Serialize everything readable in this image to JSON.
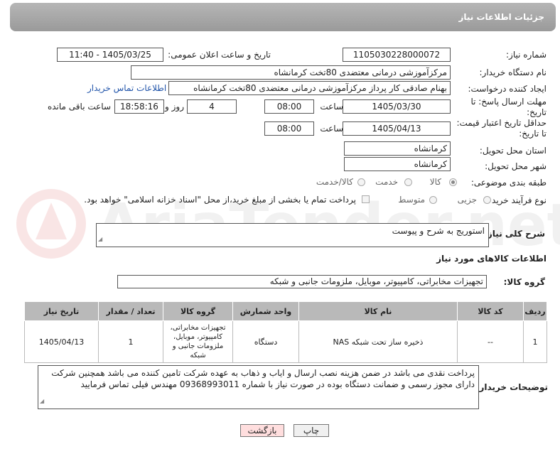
{
  "header": {
    "title": "جزئیات اطلاعات نیاز"
  },
  "fields": {
    "need_number": {
      "label": "شماره نیاز:",
      "value": "1105030228000072"
    },
    "announce_datetime": {
      "label": "تاریخ و ساعت اعلان عمومی:",
      "value": "1405/03/25 - 11:40"
    },
    "buyer_org": {
      "label": "نام دستگاه خریدار:",
      "value": "مرکزآموزشی درمانی معتضدی 80تخت کرمانشاه"
    },
    "requester": {
      "label": "ایجاد کننده درخواست:",
      "value": "بهنام صادقی کار پرداز مرکزآموزشی درمانی معتضدی 80تخت کرمانشاه"
    },
    "contact_link": "اطلاعات تماس خریدار",
    "reply_deadline": {
      "label": "مهلت ارسال پاسخ: تا تاریخ:",
      "date": "1405/03/30",
      "time_label": "ساعت",
      "time": "08:00",
      "days": "4",
      "days_label": "روز و",
      "remaining": "18:58:16",
      "remaining_label": "ساعت باقی مانده"
    },
    "price_deadline": {
      "label": "حداقل تاریخ اعتبار قیمت: تا تاریخ:",
      "date": "1405/04/13",
      "time_label": "ساعت",
      "time": "08:00"
    },
    "province": {
      "label": "استان محل تحویل:",
      "value": "کرمانشاه"
    },
    "city": {
      "label": "شهر محل تحویل:",
      "value": "کرمانشاه"
    },
    "category": {
      "label": "طبقه بندی موضوعی:",
      "options": [
        "کالا",
        "خدمت",
        "کالا/خدمت"
      ],
      "selected": "کالا"
    },
    "process_type": {
      "label": "نوع فرآیند خرید :",
      "options": [
        "جزیی",
        "متوسط"
      ],
      "selected": "جزیی",
      "note": "پرداخت تمام یا بخشی از مبلغ خرید،از محل \"اسناد خزانه اسلامی\" خواهد بود."
    }
  },
  "description": {
    "label": "شرح کلی نیاز:",
    "value": "استوریج به شرح و پیوست"
  },
  "goods_section": {
    "title": "اطلاعات کالاهای مورد نیاز",
    "group_label": "گروه کالا:",
    "group_value": "تجهیزات مخابراتی، کامپیوتر، موبایل، ملزومات جانبی و شبکه"
  },
  "table": {
    "headers": [
      "ردیف",
      "کد کالا",
      "نام کالا",
      "واحد شمارش",
      "گروه کالا",
      "تعداد / مقدار",
      "تاریخ نیاز"
    ],
    "rows": [
      [
        "1",
        "--",
        "ذخیره ساز تحت شبکه NAS",
        "دستگاه",
        "تجهیزات مخابراتی، کامپیوتر، موبایل، ملزومات جانبی و شبکه",
        "1",
        "1405/04/13"
      ]
    ]
  },
  "buyer_notes": {
    "label": "توضیحات خریدار:",
    "value": "پرداخت نقدی می باشد در ضمن هزینه نصب ارسال و ایاب و ذهاب به عهده شرکت تامین کننده می باشد همچنین شرکت دارای مجوز رسمی و ضمانت دستگاه بوده در صورت نیاز با شماره 09368993011 مهندس فیلی تماس فرمایید"
  },
  "buttons": {
    "print": "چاپ",
    "back": "بازگشت"
  },
  "watermark": "AriaTender.net",
  "colors": {
    "header": "#a8a8a8",
    "link": "#2255aa",
    "back_button": "#ffdede",
    "table_header": "#b9b9b9"
  }
}
